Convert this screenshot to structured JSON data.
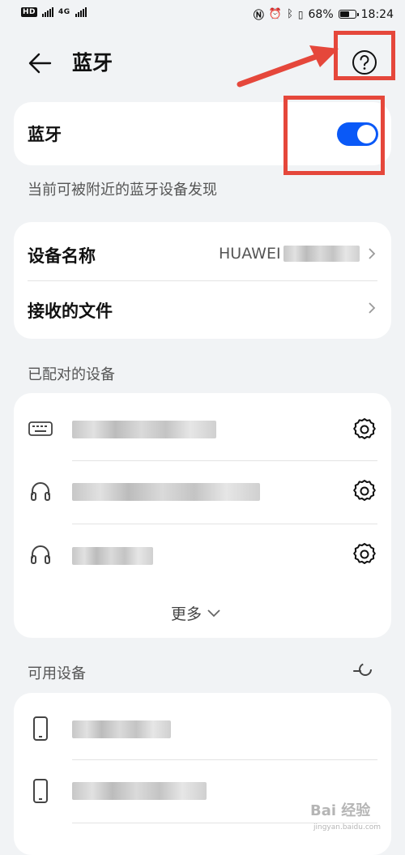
{
  "status_bar": {
    "left_network": "4G",
    "battery": "68%",
    "time": "18:24",
    "battery_level": 0.68
  },
  "header": {
    "title": "蓝牙",
    "back_icon": "back-arrow-icon",
    "help_icon": "help-circle-icon"
  },
  "bluetooth": {
    "label": "蓝牙",
    "enabled": true,
    "discoverable_text": "当前可被附近的蓝牙设备发现",
    "toggle_color": "#0a59f7"
  },
  "device_info": {
    "name_label": "设备名称",
    "name_value": "HUAWEI",
    "received_files_label": "接收的文件"
  },
  "paired": {
    "section_title": "已配对的设备",
    "devices": [
      {
        "icon": "keyboard-icon",
        "name": ""
      },
      {
        "icon": "headphones-icon",
        "name": ""
      },
      {
        "icon": "headphones-icon",
        "name": ""
      }
    ],
    "more_label": "更多"
  },
  "available": {
    "section_title": "可用设备",
    "devices": [
      {
        "icon": "phone-icon",
        "name": ""
      },
      {
        "icon": "phone-icon",
        "name": ""
      }
    ]
  },
  "watermark": {
    "text": "Bai 经验",
    "sub": "jingyan.baidu.com"
  },
  "annotation_color": "#e5473b"
}
